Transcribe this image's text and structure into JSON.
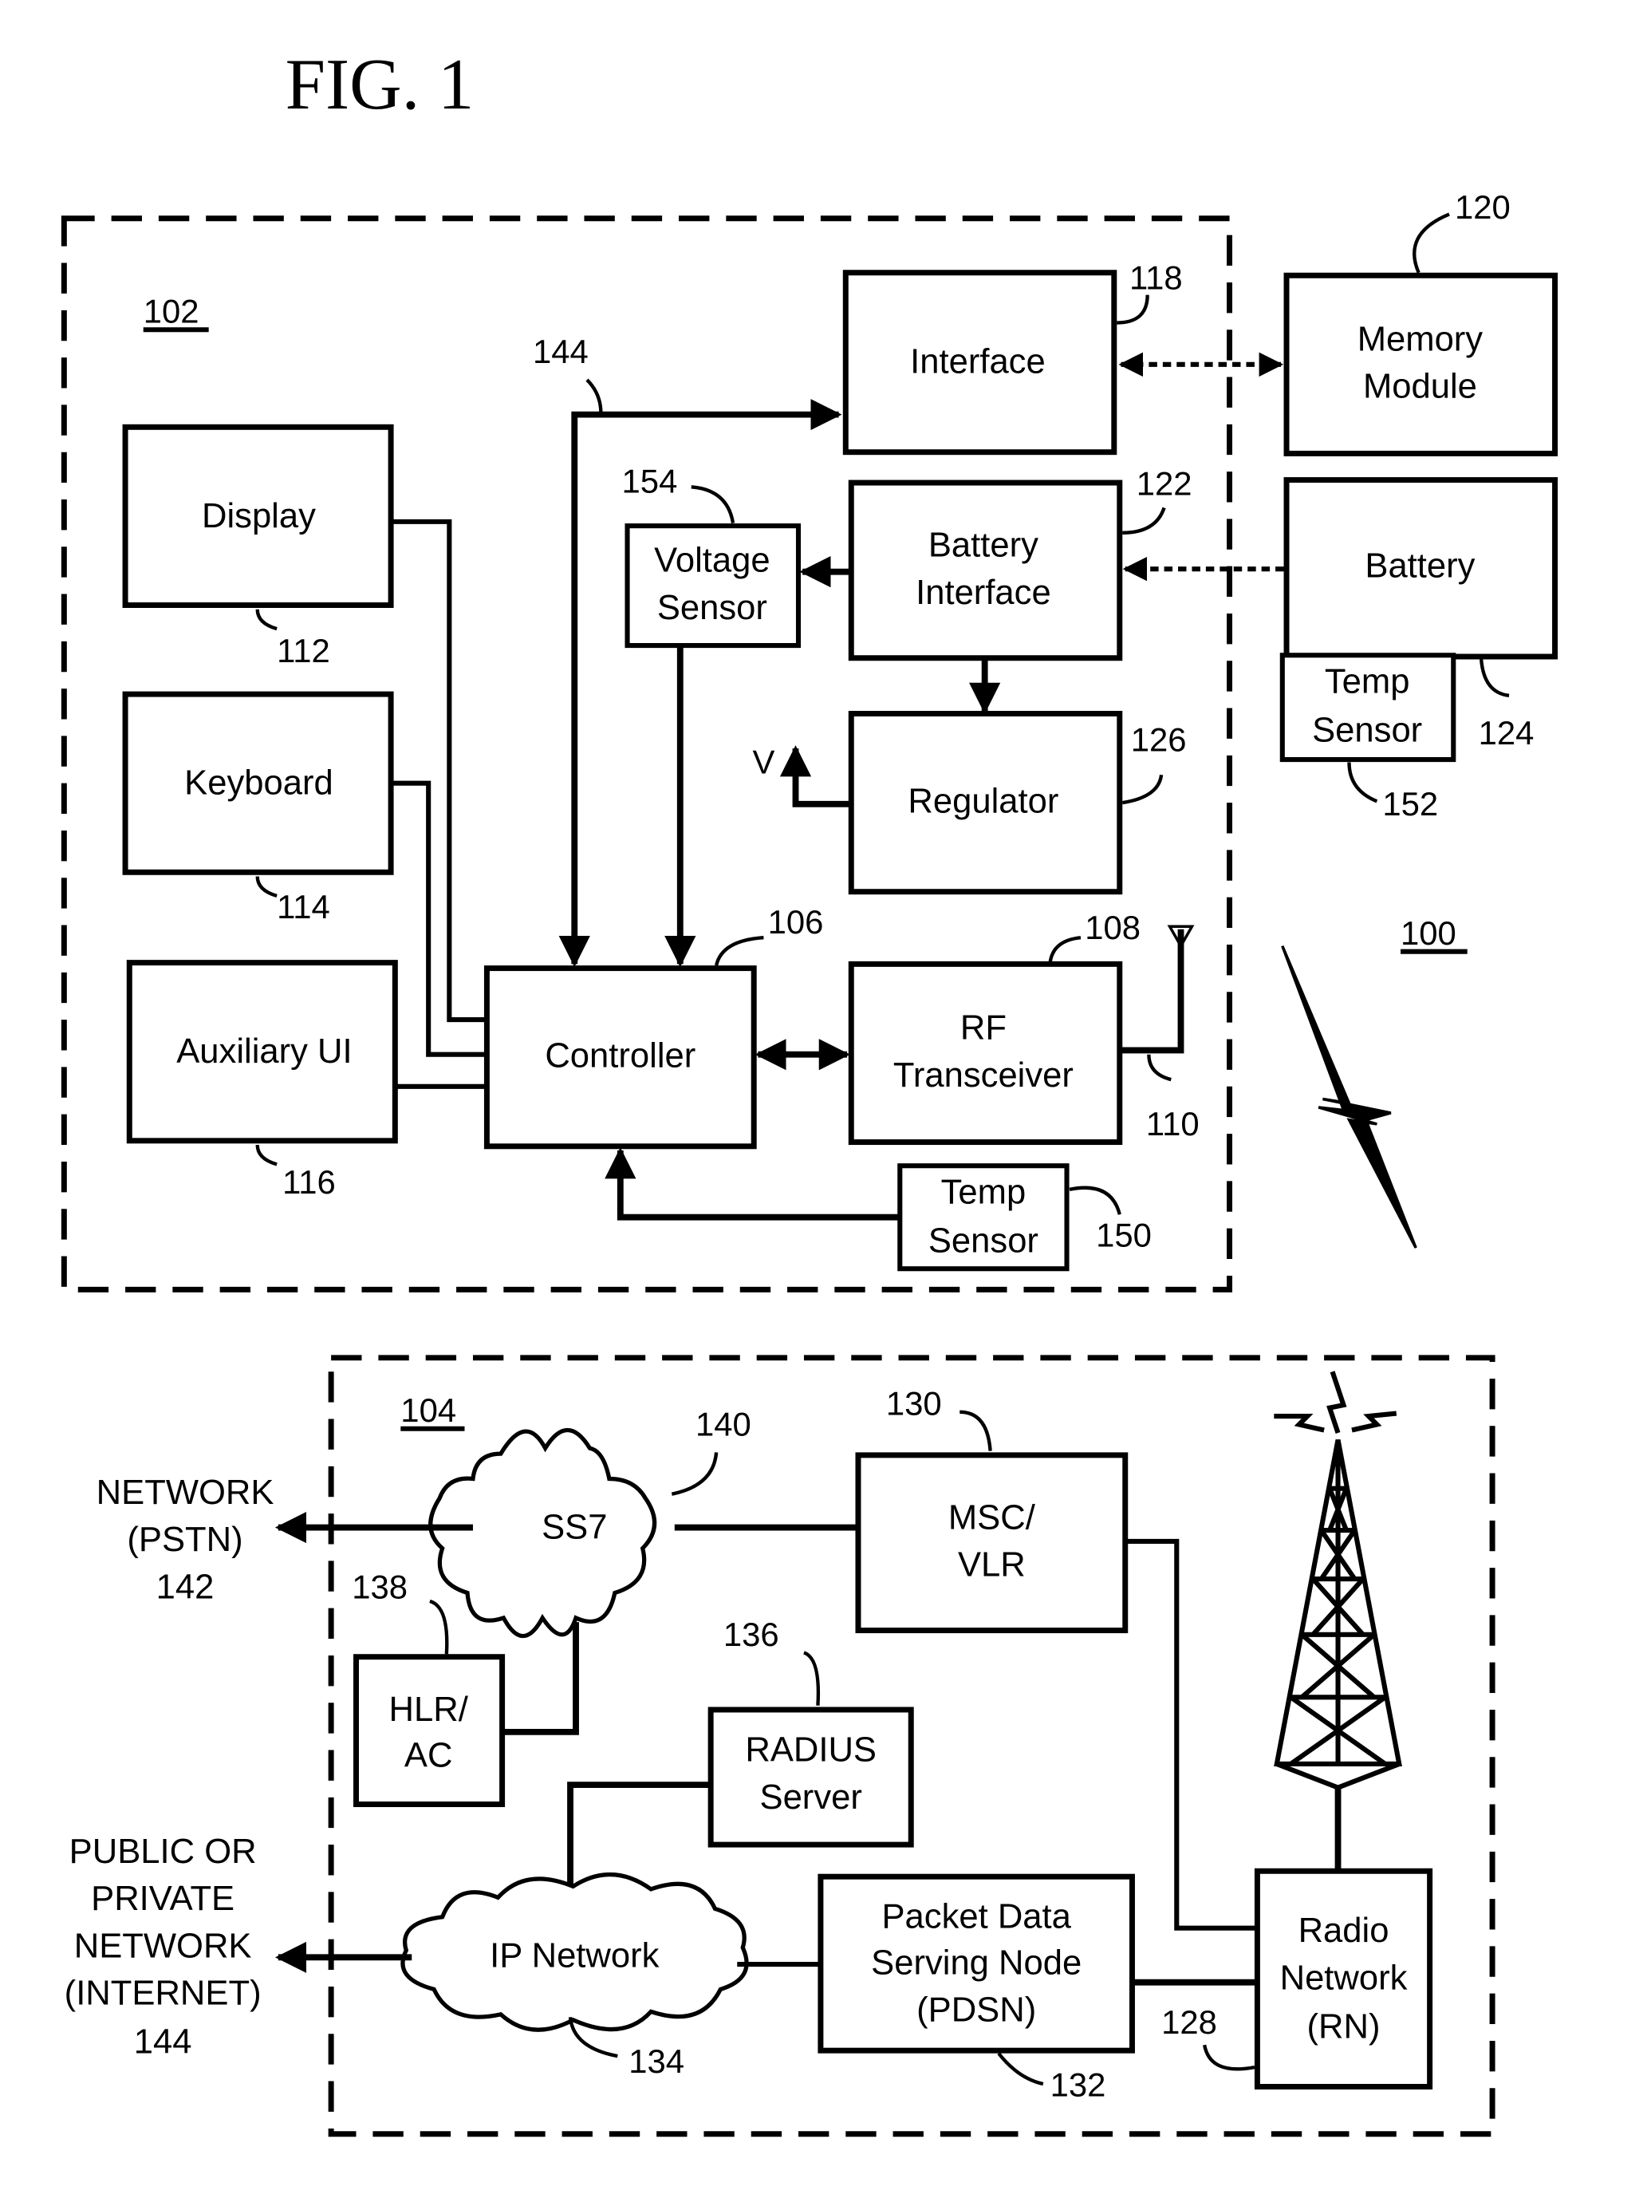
{
  "figure": {
    "title": "FIG. 1",
    "system_ref": "100"
  },
  "mobile_device": {
    "ref": "102",
    "blocks": {
      "display": {
        "label": "Display",
        "ref": "112"
      },
      "keyboard": {
        "label": "Keyboard",
        "ref": "114"
      },
      "auxiliary_ui": {
        "label": "Auxiliary UI",
        "ref": "116"
      },
      "controller": {
        "label": "Controller",
        "ref": "106"
      },
      "interface": {
        "label": "Interface",
        "ref": "118"
      },
      "voltage_sensor": {
        "line1": "Voltage",
        "line2": "Sensor",
        "ref": "154"
      },
      "battery_interface": {
        "line1": "Battery",
        "line2": "Interface",
        "ref": "122"
      },
      "regulator": {
        "label": "Regulator",
        "ref": "126",
        "output_label": "V"
      },
      "rf_transceiver": {
        "line1": "RF",
        "line2": "Transceiver",
        "ref": "108",
        "antenna_ref": "110"
      },
      "temp_sensor": {
        "line1": "Temp",
        "line2": "Sensor",
        "ref": "150"
      }
    },
    "bus_ref": "144"
  },
  "external": {
    "memory_module": {
      "line1": "Memory",
      "line2": "Module",
      "ref": "120"
    },
    "battery": {
      "label": "Battery",
      "ref": "124"
    },
    "battery_temp_sensor": {
      "line1": "Temp",
      "line2": "Sensor",
      "ref": "152"
    }
  },
  "wireless_network": {
    "ref": "104",
    "blocks": {
      "ss7": {
        "label": "SS7",
        "ref": "140"
      },
      "msc_vlr": {
        "line1": "MSC/",
        "line2": "VLR",
        "ref": "130"
      },
      "hlr_ac": {
        "line1": "HLR/",
        "line2": "AC",
        "ref": "138"
      },
      "radius": {
        "line1": "RADIUS",
        "line2": "Server",
        "ref": "136"
      },
      "ip_network": {
        "label": "IP Network",
        "ref": "134"
      },
      "pdsn": {
        "line1": "Packet Data",
        "line2": "Serving Node",
        "line3": "(PDSN)",
        "ref": "132"
      },
      "radio_network": {
        "line1": "Radio",
        "line2": "Network",
        "line3": "(RN)",
        "ref": "128"
      }
    },
    "pstn": {
      "line1": "NETWORK",
      "line2": "(PSTN)",
      "ref": "142"
    },
    "internet": {
      "line1": "PUBLIC OR",
      "line2": "PRIVATE",
      "line3": "NETWORK",
      "line4": "(INTERNET)",
      "ref": "144"
    }
  }
}
